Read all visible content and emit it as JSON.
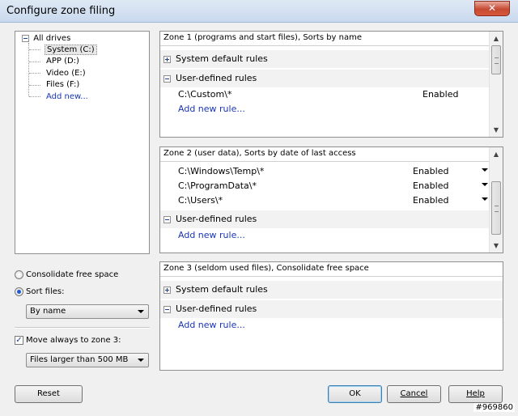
{
  "window": {
    "title": "Configure zone filing",
    "close_icon": "close-icon"
  },
  "tree": {
    "root": "All drives",
    "items": [
      "System (C:)",
      "APP (D:)",
      "Video (E:)",
      "Files (F:)"
    ],
    "add_new": "Add new..."
  },
  "zone1": {
    "header": "Zone 1 (programs and start files), Sorts by name",
    "group1": "System default rules",
    "group2": "User-defined rules",
    "rules": [
      {
        "path": "C:\\Custom\\*",
        "status": "Enabled"
      }
    ],
    "add_rule": "Add new rule..."
  },
  "zone2": {
    "header": "Zone 2 (user data), Sorts by date of last access",
    "rules": [
      {
        "path": "C:\\Windows\\Temp\\*",
        "status": "Enabled"
      },
      {
        "path": "C:\\ProgramData\\*",
        "status": "Enabled"
      },
      {
        "path": "C:\\Users\\*",
        "status": "Enabled"
      }
    ],
    "group2": "User-defined rules",
    "add_rule": "Add new rule..."
  },
  "zone3": {
    "header": "Zone 3 (seldom used files), Consolidate free space",
    "group1": "System default rules",
    "group2": "User-defined rules",
    "add_rule": "Add new rule..."
  },
  "options": {
    "consolidate": "Consolidate free space",
    "sort_files": "Sort files:",
    "sort_by": "By name",
    "move_always": "Move always to zone 3:",
    "move_filter": "Files larger than 500 MB"
  },
  "buttons": {
    "reset": "Reset",
    "ok": "OK",
    "cancel": "Cancel",
    "help": "Help"
  },
  "watermark": "#969860"
}
